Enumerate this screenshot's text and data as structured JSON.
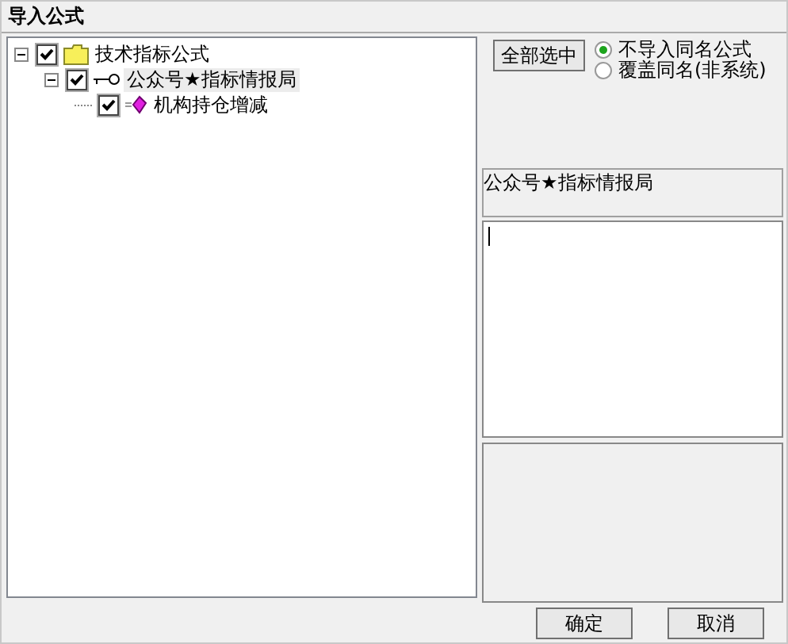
{
  "window": {
    "title": "导入公式"
  },
  "tree": [
    {
      "label": "技术指标公式",
      "kind": "folder",
      "checked": true,
      "expanded": true,
      "selected": false,
      "children": [
        {
          "label": "公众号★指标情报局",
          "kind": "key",
          "checked": true,
          "expanded": true,
          "selected": true,
          "children": [
            {
              "label": "机构持仓增减",
              "kind": "formula",
              "checked": true,
              "selected": false
            }
          ]
        }
      ]
    }
  ],
  "select_all_button": "全部选中",
  "options": [
    {
      "label": "不导入同名公式",
      "selected": true
    },
    {
      "label": "覆盖同名(非系统)",
      "selected": false
    }
  ],
  "info_label": "公众号★指标情报局",
  "buttons": [
    "确定",
    "取消"
  ]
}
